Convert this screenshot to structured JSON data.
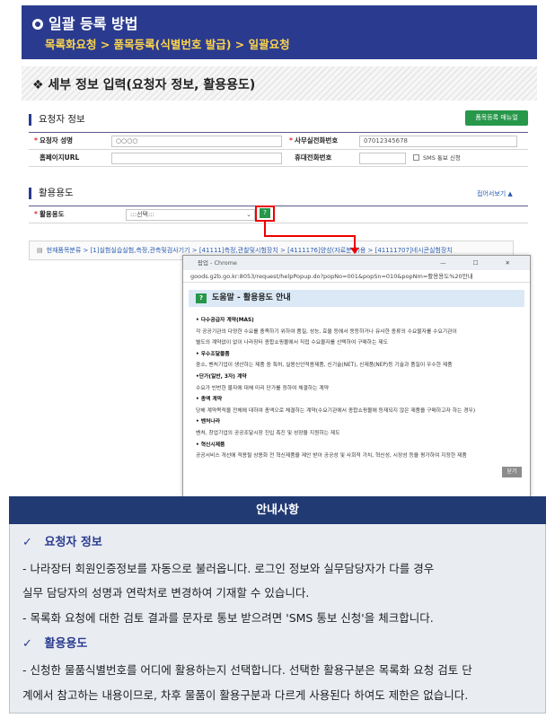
{
  "header": {
    "title": "일괄 등록 방법",
    "subtitle": "목록화요청 > 품목등록(식별번호 발급) > 일괄요청"
  },
  "section": {
    "title": "❖  세부 정보 입력(요청자 정보, 활용용도)"
  },
  "requester": {
    "group_title": "요청자 정보",
    "manual_button": "품목등록 매뉴얼",
    "rows": [
      {
        "label1": "요청자 성명",
        "value1": "○○○○",
        "label2": "사무실전화번호",
        "value2": "07012345678"
      },
      {
        "label1": "홈페이지URL",
        "value1": "",
        "label2": "휴대전화번호",
        "value2": ""
      }
    ],
    "sms_label": "SMS 통보 신청"
  },
  "usage": {
    "group_title": "활용용도",
    "collapse_label": "접어서보기 ▲",
    "label": "활용용도",
    "select_value": ":::선택:::",
    "help_icon": "?",
    "breadcrumb": "현재품목분류 > [1]실험실습실험,측정,관측및검사기기 > [41111]측정,관찰및시험장치 > [4111176]양성(자료분석)용 > [41111707]네시콘실험장치"
  },
  "popup": {
    "window_title": "팝업 - Chrome",
    "window_controls": "— ☐ ✕",
    "url": "goods.g2b.go.kr:8053/request/helpPopup.do?popNo=001&popSn=010&popNm=활용용도%20안내",
    "help_icon": "?",
    "title": "도움말 - 활용용도 안내",
    "items": [
      {
        "head": "• 다수공급자 계약(MAS)",
        "lines": [
          "각 공공기관의 다양한 수요를 충족하기 위하여 품질, 성능, 효율 등에서 동등하거나 유사한 종류의 수요물자를 수요기관이",
          "별도의 계약없이 없이 나라장터 종합쇼핑몰에서 직접 수요물자를 선택하여 구매하는 제도"
        ]
      },
      {
        "head": "• 우수조달물품",
        "lines": [
          "중소, 벤처기업이 생산하는 제품 중 특허, 실용신안적용제품, 신기술(NET), 신제품(NEP)등 기술과 품질이 우수한 제품"
        ]
      },
      {
        "head": "•단가(일반, 3자) 계약",
        "lines": [
          "수요가 빈번한 물자에 대해 미리 단가를 정하여 체결하는 계약"
        ]
      },
      {
        "head": "• 총액 계약",
        "lines": [
          "당해 계약목적물 전체에 대하여 총액으로 체결하는 계약(수요기관에서 종합쇼핑몰에 등재되지 않은 제품을 구매하고자 하는 경우)"
        ]
      },
      {
        "head": "• 벤처나라",
        "lines": [
          "벤처, 창업기업의 공공조달시장 진입 촉진 및 성장을 지원하는 제도"
        ]
      },
      {
        "head": "• 혁신시제품",
        "lines": [
          "공공서비스 개선에 적용될 상용화 전 혁신제품을 제안 받아 공공성 및 사회적 가치, 혁신성, 시장성 등을 평가하여 지정한 제품"
        ]
      }
    ],
    "close_label": "닫기"
  },
  "info": {
    "title": "안내사항",
    "sections": [
      {
        "check": "✓",
        "title": "요청자 정보",
        "lines": [
          "- 나라장터 회원인증정보를 자동으로 불러옵니다. 로그인 정보와 실무담당자가 다를 경우",
          "  실무 담당자의 성명과 연락처로 변경하여 기재할 수 있습니다.",
          "- 목록화 요청에 대한 검토 결과를 문자로 통보 받으려면 'SMS 통보 신청'을 체크합니다."
        ]
      },
      {
        "check": "✓",
        "title": "활용용도",
        "lines": [
          "- 신청한 물품식별번호를 어디에 활용하는지 선택합니다. 선택한 활용구분은 목록화 요청 검토 단",
          "계에서 참고하는 내용이므로, 차후 물품이 활용구분과 다르게 사용된다 하여도 제한은 없습니다."
        ]
      }
    ]
  },
  "colors": {
    "navy": "#2a3b8f",
    "yellow": "#ffd54a",
    "green": "#27974a",
    "red": "#e00000",
    "info_head": "#213a73",
    "info_bg": "#e9edf2"
  }
}
